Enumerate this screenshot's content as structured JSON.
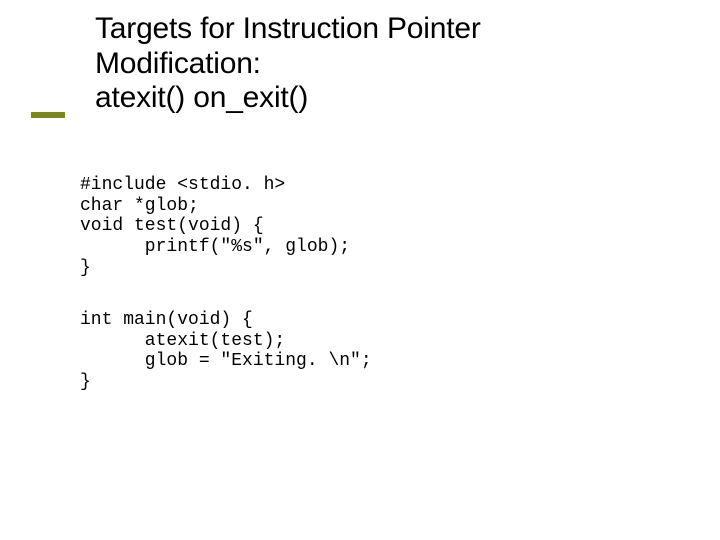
{
  "title": {
    "line1": "Targets for Instruction Pointer",
    "line2": "Modification:",
    "line3": "atexit()  on_exit()"
  },
  "code_block_1": "#include <stdio. h>\nchar *glob;\nvoid test(void) {\n      printf(\"%s\", glob);\n}",
  "code_block_2": "int main(void) {\n      atexit(test);\n      glob = \"Exiting. \\n\";\n}"
}
